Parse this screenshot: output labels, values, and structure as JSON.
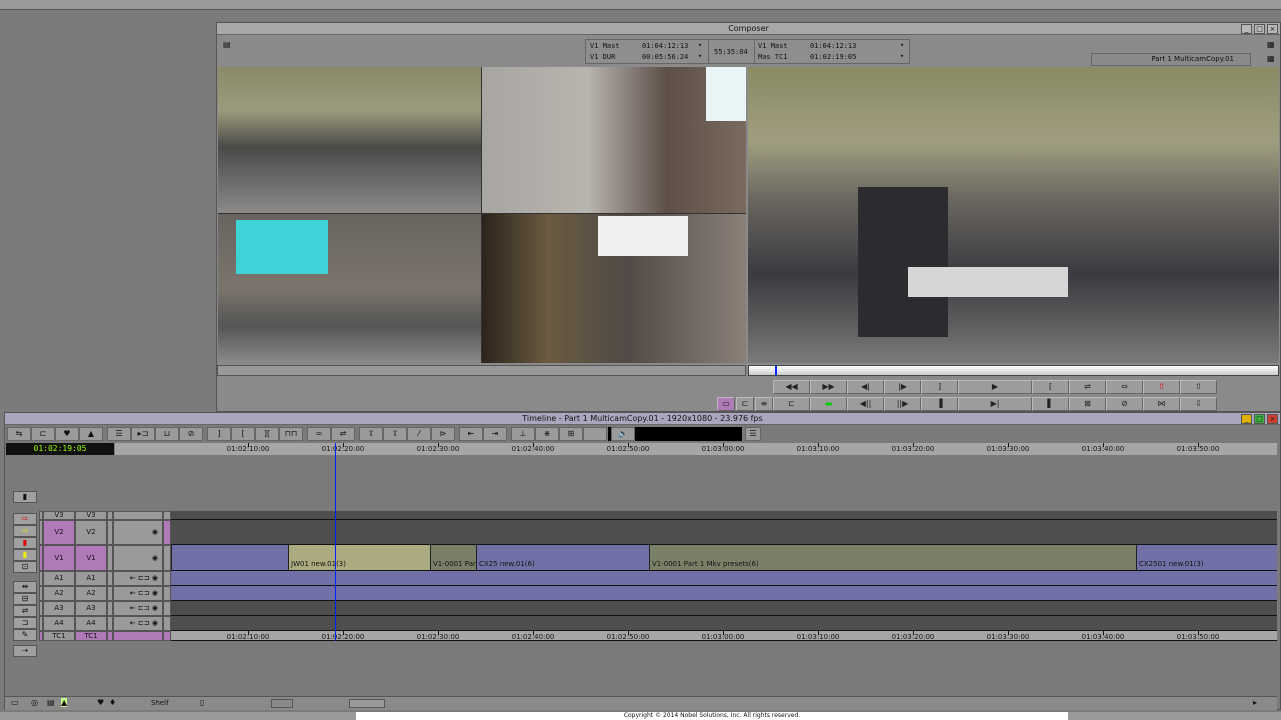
{
  "composer": {
    "title": "Composer",
    "tc": {
      "row1_label": "V1 Mast",
      "row1_value": "01:04:12:13",
      "row2_label": "V1 DUR",
      "row2_value": "00:05:56:24",
      "center": "55:35:04",
      "row3_label": "V1 Mast",
      "row3_value": "01:04:12:13",
      "row4_label": "Mas TC1",
      "row4_value": "01:02:19:05"
    },
    "sequence_name": "Part 1 MulticamCopy.01",
    "transport_row1": [
      "◀◀",
      "▶▶",
      "◀|",
      "|▶",
      "]",
      "▶",
      "[",
      "⇌",
      "⇔",
      "⇧",
      "⇧"
    ],
    "transport_row2": [
      "⊏",
      "▬",
      "◀||",
      "||▶",
      "▐",
      "▶|",
      "▌",
      "⊠",
      "⊘",
      "⋈",
      "⇩"
    ],
    "view_buttons": [
      "▭",
      "⊏",
      "≡"
    ]
  },
  "timeline": {
    "title": "Timeline - Part 1 MulticamCopy.01 - 1920x1080 - 23.976 fps",
    "current_tc": "01:02:19:05",
    "toolbar": [
      "⇆",
      "⊏",
      "♥",
      "▲",
      "☰",
      "▸⊐",
      "⊔",
      "⊘",
      "]",
      "[",
      "][",
      "⊓⊓",
      "=",
      "⇌",
      "⇧",
      "⇧",
      "⁄",
      "⊳",
      "⇤",
      "⇥",
      "⊥",
      "⋇",
      "⊞",
      "",
      "🔈"
    ],
    "ruler_labels": [
      "01:02:10:00",
      "01:02:20:00",
      "01:02:30:00",
      "01:02:40:00",
      "01:02:50:00",
      "01:03:00:00",
      "01:03:10:00",
      "01:03:20:00",
      "01:03:30:00",
      "01:03:40:00",
      "01:03:50:00"
    ],
    "tc_track_labels": [
      "01:02:10:00",
      "01:02:20:00",
      "01:02:30:00",
      "01:02:40:00",
      "01:02:50:00",
      "01:03:00:00",
      "01:03:10:00",
      "01:03:20:00",
      "01:03:30:00",
      "01:03:40:00",
      "01:03:50:00"
    ],
    "tracks": [
      {
        "src": "V3",
        "rec": "V3"
      },
      {
        "src": "V2",
        "rec": "V2"
      },
      {
        "src": "V1",
        "rec": "V1"
      },
      {
        "src": "A1",
        "rec": "A1"
      },
      {
        "src": "A2",
        "rec": "A2"
      },
      {
        "src": "A3",
        "rec": "A3"
      },
      {
        "src": "A4",
        "rec": "A4"
      },
      {
        "src": "TC1",
        "rec": "TC1"
      }
    ],
    "v1_clips": [
      "",
      "JW01 new.01(3)",
      "V1-0001 Part",
      "CX25 new.01(6)",
      "V1-0001 Part 1 Mkv presets(6)",
      "CX2501 new.01(3)"
    ],
    "bottom": {
      "zoom_label": "Shelf"
    }
  },
  "status": {
    "copyright": "Copyright © 2014 Nobel Solutions, Inc. All rights reserved."
  },
  "colors": {
    "purple": "#b07ab8",
    "clip_blue": "#7170a6",
    "clip_yellow": "#acab80",
    "clip_olive": "#7a8068"
  }
}
